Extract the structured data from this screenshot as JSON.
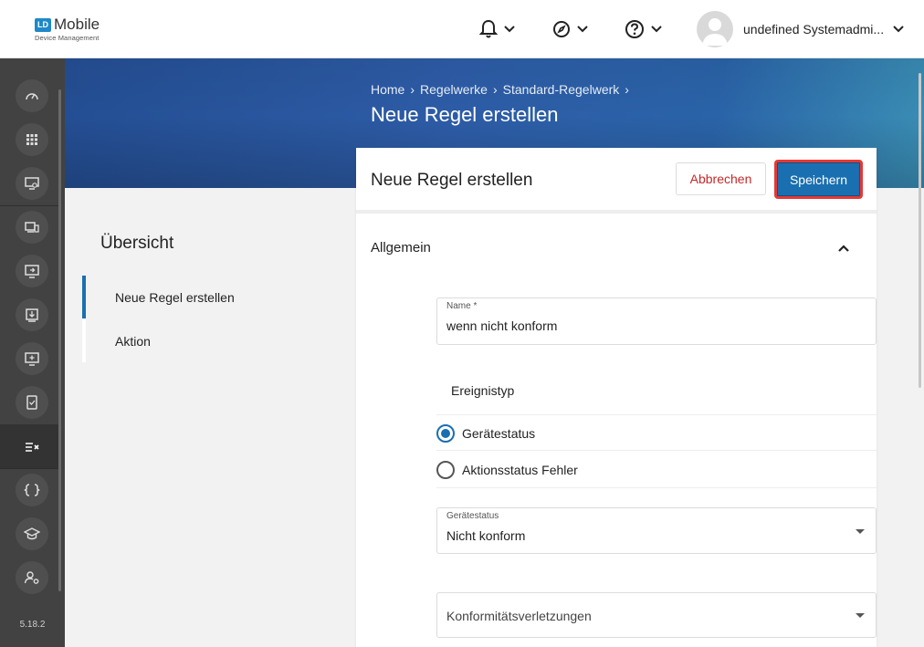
{
  "app": {
    "logo_mark": "LD",
    "logo_title": "Mobile",
    "logo_subtitle": "Device Management",
    "user_name": "undefined Systemadmi...",
    "version": "5.18.2"
  },
  "topbar": {
    "icons": [
      "bell-icon",
      "compass-icon",
      "help-icon"
    ]
  },
  "sidebar": {
    "items": [
      {
        "icon": "dashboard-icon"
      },
      {
        "icon": "apps-grid-icon"
      },
      {
        "icon": "device-settings-icon"
      },
      {
        "icon": "devices-icon"
      },
      {
        "icon": "device-assign-icon"
      },
      {
        "icon": "download-device-icon"
      },
      {
        "icon": "add-device-icon"
      },
      {
        "icon": "compliance-device-icon"
      },
      {
        "icon": "rules-icon",
        "active": true
      },
      {
        "icon": "code-braces-icon"
      },
      {
        "icon": "education-icon"
      },
      {
        "icon": "user-settings-icon"
      }
    ]
  },
  "banner": {
    "breadcrumb": [
      "Home",
      "Regelwerke",
      "Standard-Regelwerk"
    ],
    "title": "Neue Regel erstellen"
  },
  "overview": {
    "title": "Übersicht",
    "items": [
      {
        "label": "Neue Regel erstellen",
        "active": true
      },
      {
        "label": "Aktion",
        "active": false
      }
    ]
  },
  "card": {
    "title": "Neue Regel erstellen",
    "cancel_label": "Abbrechen",
    "save_label": "Speichern",
    "section": "Allgemein",
    "name_field": {
      "label": "Name *",
      "value": "wenn nicht konform"
    },
    "event_type_label": "Ereignistyp",
    "event_options": [
      {
        "label": "Gerätestatus",
        "selected": true
      },
      {
        "label": "Aktionsstatus Fehler",
        "selected": false
      }
    ],
    "device_status_select": {
      "label": "Gerätestatus",
      "value": "Nicht konform"
    },
    "compliance_select": {
      "placeholder": "Konformitätsverletzungen"
    }
  },
  "colors": {
    "primary": "#1a6fb0",
    "danger": "#c62828",
    "highlight_border": "#e53935",
    "sidebar": "#424242"
  }
}
